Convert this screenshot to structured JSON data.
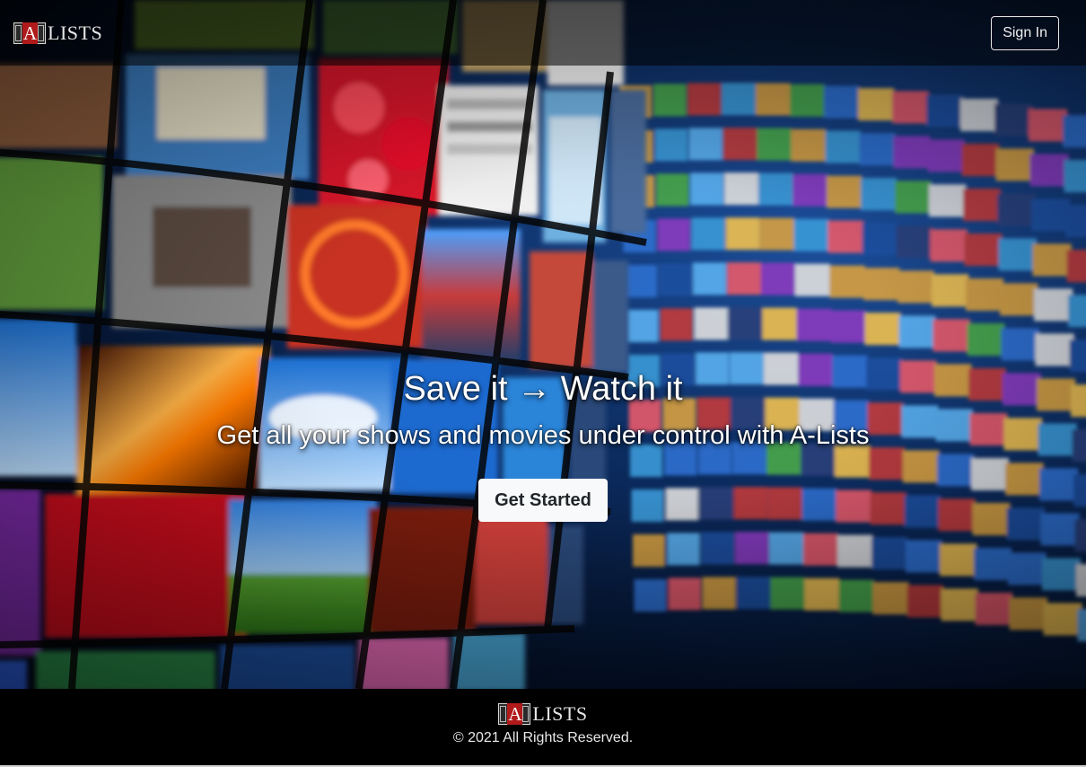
{
  "header": {
    "logo_letter": "A",
    "logo_text": "LISTS",
    "signin_label": "Sign In"
  },
  "hero": {
    "headline": "Save it → Watch it",
    "subheadline": "Get all your shows and movies under control with A-Lists",
    "cta_label": "Get Started"
  },
  "footer": {
    "logo_letter": "A",
    "logo_text": "LISTS",
    "copyright": "© 2021 All Rights Reserved."
  },
  "colors": {
    "brand_red": "#b11a1a",
    "cta_bg": "#f8f9fa",
    "header_bg": "rgba(0,0,0,0.55)"
  }
}
